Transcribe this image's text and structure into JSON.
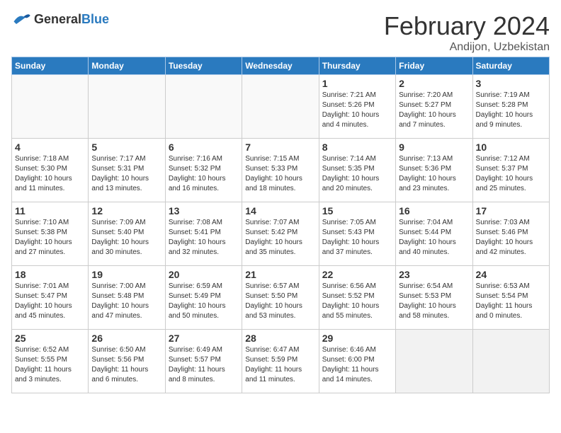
{
  "header": {
    "logo_general": "General",
    "logo_blue": "Blue",
    "month_year": "February 2024",
    "location": "Andijon, Uzbekistan"
  },
  "days_of_week": [
    "Sunday",
    "Monday",
    "Tuesday",
    "Wednesday",
    "Thursday",
    "Friday",
    "Saturday"
  ],
  "weeks": [
    [
      {
        "day": "",
        "info": "",
        "empty": true
      },
      {
        "day": "",
        "info": "",
        "empty": true
      },
      {
        "day": "",
        "info": "",
        "empty": true
      },
      {
        "day": "",
        "info": "",
        "empty": true
      },
      {
        "day": "1",
        "info": "Sunrise: 7:21 AM\nSunset: 5:26 PM\nDaylight: 10 hours\nand 4 minutes."
      },
      {
        "day": "2",
        "info": "Sunrise: 7:20 AM\nSunset: 5:27 PM\nDaylight: 10 hours\nand 7 minutes."
      },
      {
        "day": "3",
        "info": "Sunrise: 7:19 AM\nSunset: 5:28 PM\nDaylight: 10 hours\nand 9 minutes."
      }
    ],
    [
      {
        "day": "4",
        "info": "Sunrise: 7:18 AM\nSunset: 5:30 PM\nDaylight: 10 hours\nand 11 minutes."
      },
      {
        "day": "5",
        "info": "Sunrise: 7:17 AM\nSunset: 5:31 PM\nDaylight: 10 hours\nand 13 minutes."
      },
      {
        "day": "6",
        "info": "Sunrise: 7:16 AM\nSunset: 5:32 PM\nDaylight: 10 hours\nand 16 minutes."
      },
      {
        "day": "7",
        "info": "Sunrise: 7:15 AM\nSunset: 5:33 PM\nDaylight: 10 hours\nand 18 minutes."
      },
      {
        "day": "8",
        "info": "Sunrise: 7:14 AM\nSunset: 5:35 PM\nDaylight: 10 hours\nand 20 minutes."
      },
      {
        "day": "9",
        "info": "Sunrise: 7:13 AM\nSunset: 5:36 PM\nDaylight: 10 hours\nand 23 minutes."
      },
      {
        "day": "10",
        "info": "Sunrise: 7:12 AM\nSunset: 5:37 PM\nDaylight: 10 hours\nand 25 minutes."
      }
    ],
    [
      {
        "day": "11",
        "info": "Sunrise: 7:10 AM\nSunset: 5:38 PM\nDaylight: 10 hours\nand 27 minutes."
      },
      {
        "day": "12",
        "info": "Sunrise: 7:09 AM\nSunset: 5:40 PM\nDaylight: 10 hours\nand 30 minutes."
      },
      {
        "day": "13",
        "info": "Sunrise: 7:08 AM\nSunset: 5:41 PM\nDaylight: 10 hours\nand 32 minutes."
      },
      {
        "day": "14",
        "info": "Sunrise: 7:07 AM\nSunset: 5:42 PM\nDaylight: 10 hours\nand 35 minutes."
      },
      {
        "day": "15",
        "info": "Sunrise: 7:05 AM\nSunset: 5:43 PM\nDaylight: 10 hours\nand 37 minutes."
      },
      {
        "day": "16",
        "info": "Sunrise: 7:04 AM\nSunset: 5:44 PM\nDaylight: 10 hours\nand 40 minutes."
      },
      {
        "day": "17",
        "info": "Sunrise: 7:03 AM\nSunset: 5:46 PM\nDaylight: 10 hours\nand 42 minutes."
      }
    ],
    [
      {
        "day": "18",
        "info": "Sunrise: 7:01 AM\nSunset: 5:47 PM\nDaylight: 10 hours\nand 45 minutes."
      },
      {
        "day": "19",
        "info": "Sunrise: 7:00 AM\nSunset: 5:48 PM\nDaylight: 10 hours\nand 47 minutes."
      },
      {
        "day": "20",
        "info": "Sunrise: 6:59 AM\nSunset: 5:49 PM\nDaylight: 10 hours\nand 50 minutes."
      },
      {
        "day": "21",
        "info": "Sunrise: 6:57 AM\nSunset: 5:50 PM\nDaylight: 10 hours\nand 53 minutes."
      },
      {
        "day": "22",
        "info": "Sunrise: 6:56 AM\nSunset: 5:52 PM\nDaylight: 10 hours\nand 55 minutes."
      },
      {
        "day": "23",
        "info": "Sunrise: 6:54 AM\nSunset: 5:53 PM\nDaylight: 10 hours\nand 58 minutes."
      },
      {
        "day": "24",
        "info": "Sunrise: 6:53 AM\nSunset: 5:54 PM\nDaylight: 11 hours\nand 0 minutes."
      }
    ],
    [
      {
        "day": "25",
        "info": "Sunrise: 6:52 AM\nSunset: 5:55 PM\nDaylight: 11 hours\nand 3 minutes."
      },
      {
        "day": "26",
        "info": "Sunrise: 6:50 AM\nSunset: 5:56 PM\nDaylight: 11 hours\nand 6 minutes."
      },
      {
        "day": "27",
        "info": "Sunrise: 6:49 AM\nSunset: 5:57 PM\nDaylight: 11 hours\nand 8 minutes."
      },
      {
        "day": "28",
        "info": "Sunrise: 6:47 AM\nSunset: 5:59 PM\nDaylight: 11 hours\nand 11 minutes."
      },
      {
        "day": "29",
        "info": "Sunrise: 6:46 AM\nSunset: 6:00 PM\nDaylight: 11 hours\nand 14 minutes."
      },
      {
        "day": "",
        "info": "",
        "empty": true,
        "shaded": true
      },
      {
        "day": "",
        "info": "",
        "empty": true,
        "shaded": true
      }
    ]
  ]
}
